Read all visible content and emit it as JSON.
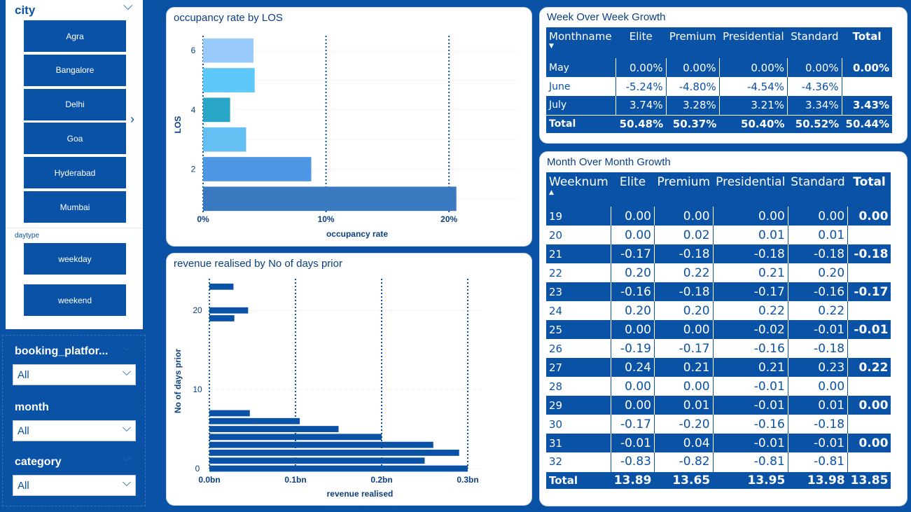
{
  "city_slicer": {
    "title": "city",
    "items": [
      "Agra",
      "Bangalore",
      "Delhi",
      "Goa",
      "Hyderabad",
      "Mumbai"
    ]
  },
  "daytype_slicer": {
    "title": "daytype",
    "items": [
      "weekday",
      "weekend"
    ]
  },
  "dropdowns": {
    "booking_platform": {
      "label": "booking_platfor...",
      "value": "All"
    },
    "month": {
      "label": "month",
      "value": "All"
    },
    "category": {
      "label": "category",
      "value": "All"
    }
  },
  "chart1_title": "occupancy rate by LOS",
  "chart2_title": "revenue realised by No of days prior",
  "chart_data": [
    {
      "type": "bar",
      "orientation": "horizontal",
      "title": "occupancy rate by LOS",
      "xlabel": "occupancy rate",
      "ylabel": "LOS",
      "y": [
        1,
        2,
        3,
        4,
        5,
        6
      ],
      "values": [
        0.206,
        0.088,
        0.035,
        0.022,
        0.042,
        0.041
      ],
      "colors": [
        "#3a78bf",
        "#4e97e4",
        "#64bff2",
        "#2aa7c8",
        "#5ec9f8",
        "#99ccfd"
      ],
      "xlim": [
        0,
        0.25
      ],
      "xticks": [
        "0%",
        "10%",
        "20%"
      ],
      "yticks": [
        "2",
        "4",
        "6"
      ],
      "grid": true
    },
    {
      "type": "bar",
      "orientation": "horizontal",
      "title": "revenue realised by No of days prior",
      "xlabel": "revenue realised",
      "ylabel": "No of days prior",
      "y": [
        0,
        1,
        2,
        3,
        4,
        5,
        6,
        7,
        19,
        20,
        23
      ],
      "values": [
        0.3,
        0.25,
        0.29,
        0.26,
        0.2,
        0.15,
        0.105,
        0.047,
        0.029,
        0.045,
        0.028
      ],
      "xlim": [
        0,
        0.32
      ],
      "xticks": [
        "0.0bn",
        "0.1bn",
        "0.2bn",
        "0.3bn"
      ],
      "yticks": [
        "0",
        "10",
        "20"
      ],
      "grid": true
    }
  ],
  "wow": {
    "title": "Week Over Week Growth",
    "headers": [
      "Monthname",
      "Elite",
      "Premium",
      "Presidential",
      "Standard",
      "Total"
    ],
    "rows": [
      [
        "May",
        "0.00%",
        "0.00%",
        "0.00%",
        "0.00%",
        "0.00%"
      ],
      [
        "June",
        "-5.24%",
        "-4.80%",
        "-4.54%",
        "-4.36%",
        ""
      ],
      [
        "July",
        "3.74%",
        "3.28%",
        "3.21%",
        "3.34%",
        "3.43%"
      ]
    ],
    "total": [
      "Total",
      "50.48%",
      "50.37%",
      "50.40%",
      "50.52%",
      "50.44%"
    ]
  },
  "mom": {
    "title": "Month Over Month Growth",
    "headers": [
      "Weeknum",
      "Elite",
      "Premium",
      "Presidential",
      "Standard",
      "Total"
    ],
    "rows": [
      [
        "19",
        "0.00",
        "0.00",
        "0.00",
        "0.00",
        "0.00"
      ],
      [
        "20",
        "0.00",
        "0.02",
        "0.01",
        "0.01",
        ""
      ],
      [
        "21",
        "-0.17",
        "-0.18",
        "-0.18",
        "-0.18",
        "-0.18"
      ],
      [
        "22",
        "0.20",
        "0.22",
        "0.21",
        "0.20",
        ""
      ],
      [
        "23",
        "-0.16",
        "-0.18",
        "-0.17",
        "-0.16",
        "-0.17"
      ],
      [
        "24",
        "0.20",
        "0.20",
        "0.22",
        "0.22",
        ""
      ],
      [
        "25",
        "0.00",
        "0.00",
        "-0.02",
        "-0.01",
        "-0.01"
      ],
      [
        "26",
        "-0.19",
        "-0.17",
        "-0.16",
        "-0.18",
        ""
      ],
      [
        "27",
        "0.24",
        "0.21",
        "0.21",
        "0.23",
        "0.22"
      ],
      [
        "28",
        "0.00",
        "0.00",
        "-0.01",
        "0.00",
        ""
      ],
      [
        "29",
        "0.00",
        "0.01",
        "-0.01",
        "0.01",
        "0.00"
      ],
      [
        "30",
        "-0.17",
        "-0.20",
        "-0.16",
        "-0.18",
        ""
      ],
      [
        "31",
        "-0.01",
        "0.04",
        "-0.01",
        "-0.01",
        "0.00"
      ],
      [
        "32",
        "-0.83",
        "-0.82",
        "-0.81",
        "-0.81",
        ""
      ]
    ],
    "total": [
      "Total",
      "13.89",
      "13.65",
      "13.95",
      "13.98",
      "13.85"
    ]
  }
}
